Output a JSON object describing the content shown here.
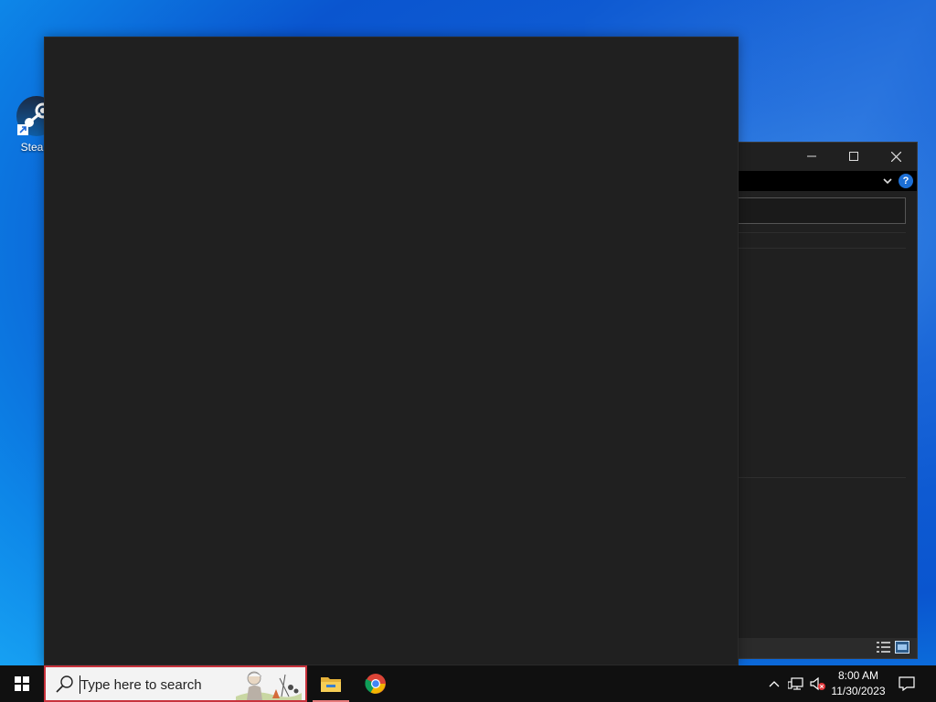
{
  "desktop": {
    "icons": [
      {
        "label": "Steam",
        "icon": "steam-icon"
      }
    ]
  },
  "background_window": {
    "controls": [
      "minimize-icon",
      "maximize-icon",
      "close-icon"
    ],
    "help_label": "?"
  },
  "taskbar": {
    "search": {
      "placeholder": "Type here to search"
    },
    "pinned_apps": [
      "file-explorer-icon",
      "chrome-icon"
    ],
    "tray": [
      "chevron-up-icon",
      "network-icon",
      "volume-muted-icon",
      "notification-icon"
    ],
    "clock": {
      "time": "8:00 AM",
      "date": "11/30/2023"
    }
  },
  "colors": {
    "window_bg": "#202020",
    "taskbar_bg": "#101010",
    "search_border": "#c8323c",
    "wallpaper": "#0a55cf"
  }
}
